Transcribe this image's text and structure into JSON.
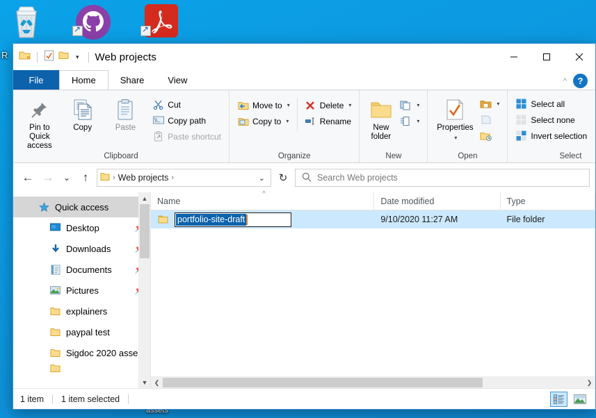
{
  "desktop": {
    "icons": [
      {
        "name": "recycle-bin",
        "label": ""
      },
      {
        "name": "github-desktop",
        "label": ""
      },
      {
        "name": "adobe-acrobat",
        "label": ""
      }
    ],
    "left_label_fragment": "R",
    "bottom_label_fragment": "assets"
  },
  "window": {
    "title": "Web projects",
    "quick_access": {
      "folder_icon": "folder-icon",
      "properties_icon": "properties-icon",
      "new_folder_icon": "new-folder-icon",
      "customize_caret": "▾"
    },
    "controls": {
      "minimize": "minimize-icon",
      "maximize": "maximize-icon",
      "close": "close-icon",
      "collapse_ribbon": "^",
      "help": "?"
    }
  },
  "ribbon": {
    "tabs": [
      {
        "label": "File",
        "active": false,
        "file": true
      },
      {
        "label": "Home",
        "active": true,
        "file": false
      },
      {
        "label": "Share",
        "active": false,
        "file": false
      },
      {
        "label": "View",
        "active": false,
        "file": false
      }
    ],
    "groups": {
      "clipboard": {
        "title": "Clipboard",
        "pin_to_quick_access": "Pin to Quick\naccess",
        "pin_line1": "Pin to Quick",
        "pin_line2": "access",
        "copy": "Copy",
        "paste": "Paste",
        "cut": "Cut",
        "copy_path": "Copy path",
        "paste_shortcut": "Paste shortcut"
      },
      "organize": {
        "title": "Organize",
        "move_to": "Move to",
        "copy_to": "Copy to",
        "delete": "Delete",
        "rename": "Rename"
      },
      "new": {
        "title": "New",
        "new_folder_line1": "New",
        "new_folder_line2": "folder"
      },
      "open": {
        "title": "Open",
        "properties": "Properties"
      },
      "select": {
        "title": "Select",
        "select_all": "Select all",
        "select_none": "Select none",
        "invert_selection": "Invert selection"
      }
    }
  },
  "address_bar": {
    "back": "←",
    "forward": "→",
    "recent": "⌄",
    "up": "↑",
    "crumb_sep1": "›",
    "crumb": "Web projects",
    "crumb_sep2": "›",
    "dropdown": "⌄",
    "refresh": "↻",
    "search_placeholder": "Search Web projects"
  },
  "nav_pane": {
    "items": [
      {
        "label": "Quick access",
        "icon": "star-icon",
        "level": 0,
        "selected": true,
        "pinned": false
      },
      {
        "label": "Desktop",
        "icon": "desktop-icon",
        "level": 1,
        "selected": false,
        "pinned": true
      },
      {
        "label": "Downloads",
        "icon": "downloads-icon",
        "level": 1,
        "selected": false,
        "pinned": true
      },
      {
        "label": "Documents",
        "icon": "documents-icon",
        "level": 1,
        "selected": false,
        "pinned": true
      },
      {
        "label": "Pictures",
        "icon": "pictures-icon",
        "level": 1,
        "selected": false,
        "pinned": true
      },
      {
        "label": "explainers",
        "icon": "folder-icon",
        "level": 1,
        "selected": false,
        "pinned": false
      },
      {
        "label": "paypal test",
        "icon": "folder-icon",
        "level": 1,
        "selected": false,
        "pinned": false
      },
      {
        "label": "Sigdoc 2020 asse",
        "icon": "folder-icon",
        "level": 1,
        "selected": false,
        "pinned": false
      }
    ]
  },
  "file_list": {
    "columns": [
      {
        "label": "Name",
        "sorted": true
      },
      {
        "label": "Date modified",
        "sorted": false
      },
      {
        "label": "Type",
        "sorted": false
      }
    ],
    "sort_caret": "^",
    "rows": [
      {
        "name": "portfolio-site-draft",
        "date_modified": "9/10/2020 11:27 AM",
        "type": "File folder",
        "selected": true,
        "renaming": true
      }
    ]
  },
  "status_bar": {
    "item_count": "1 item",
    "selection_count": "1 item selected",
    "view_details": "details-view-icon",
    "view_large_icons": "large-icons-view-icon"
  }
}
